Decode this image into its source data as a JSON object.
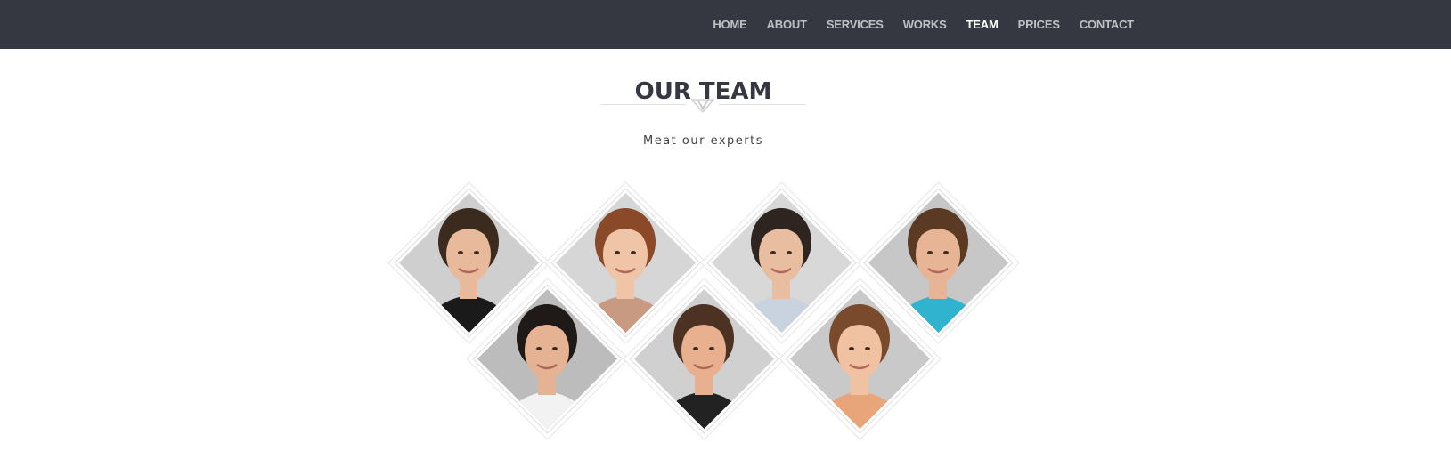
{
  "nav": {
    "items": [
      {
        "label": "HOME",
        "active": false
      },
      {
        "label": "ABOUT",
        "active": false
      },
      {
        "label": "SERVICES",
        "active": false
      },
      {
        "label": "WORKS",
        "active": false
      },
      {
        "label": "TEAM",
        "active": true
      },
      {
        "label": "PRICES",
        "active": false
      },
      {
        "label": "CONTACT",
        "active": false
      }
    ]
  },
  "section": {
    "title": "OUR TEAM",
    "subtitle": "Meat our experts"
  },
  "colors": {
    "navbar_bg": "#353840",
    "nav_text": "#bfc0c3",
    "nav_active": "#ffffff",
    "title": "#353840"
  },
  "team": [
    {
      "hair": "#3b2a1e",
      "skin": "#e8b99a",
      "shirt": "#1a1a1a",
      "bg": "#cfcfcf"
    },
    {
      "hair": "#8a4a2a",
      "skin": "#f0c4a6",
      "shirt": "#c89a82",
      "bg": "#d6d6d6"
    },
    {
      "hair": "#2e2520",
      "skin": "#e9bda0",
      "shirt": "#c9d3e0",
      "bg": "#d8d8d8"
    },
    {
      "hair": "#5a3a22",
      "skin": "#e7b496",
      "shirt": "#2fb3cf",
      "bg": "#c7c7c7"
    },
    {
      "hair": "#1f1a17",
      "skin": "#e5b294",
      "shirt": "#f2f2f2",
      "bg": "#bcbcbc"
    },
    {
      "hair": "#4b3222",
      "skin": "#e8b08f",
      "shirt": "#222222",
      "bg": "#d0d0d0"
    },
    {
      "hair": "#7a4a2c",
      "skin": "#f0c2a2",
      "shirt": "#e8a57a",
      "bg": "#c9c9c9"
    }
  ]
}
